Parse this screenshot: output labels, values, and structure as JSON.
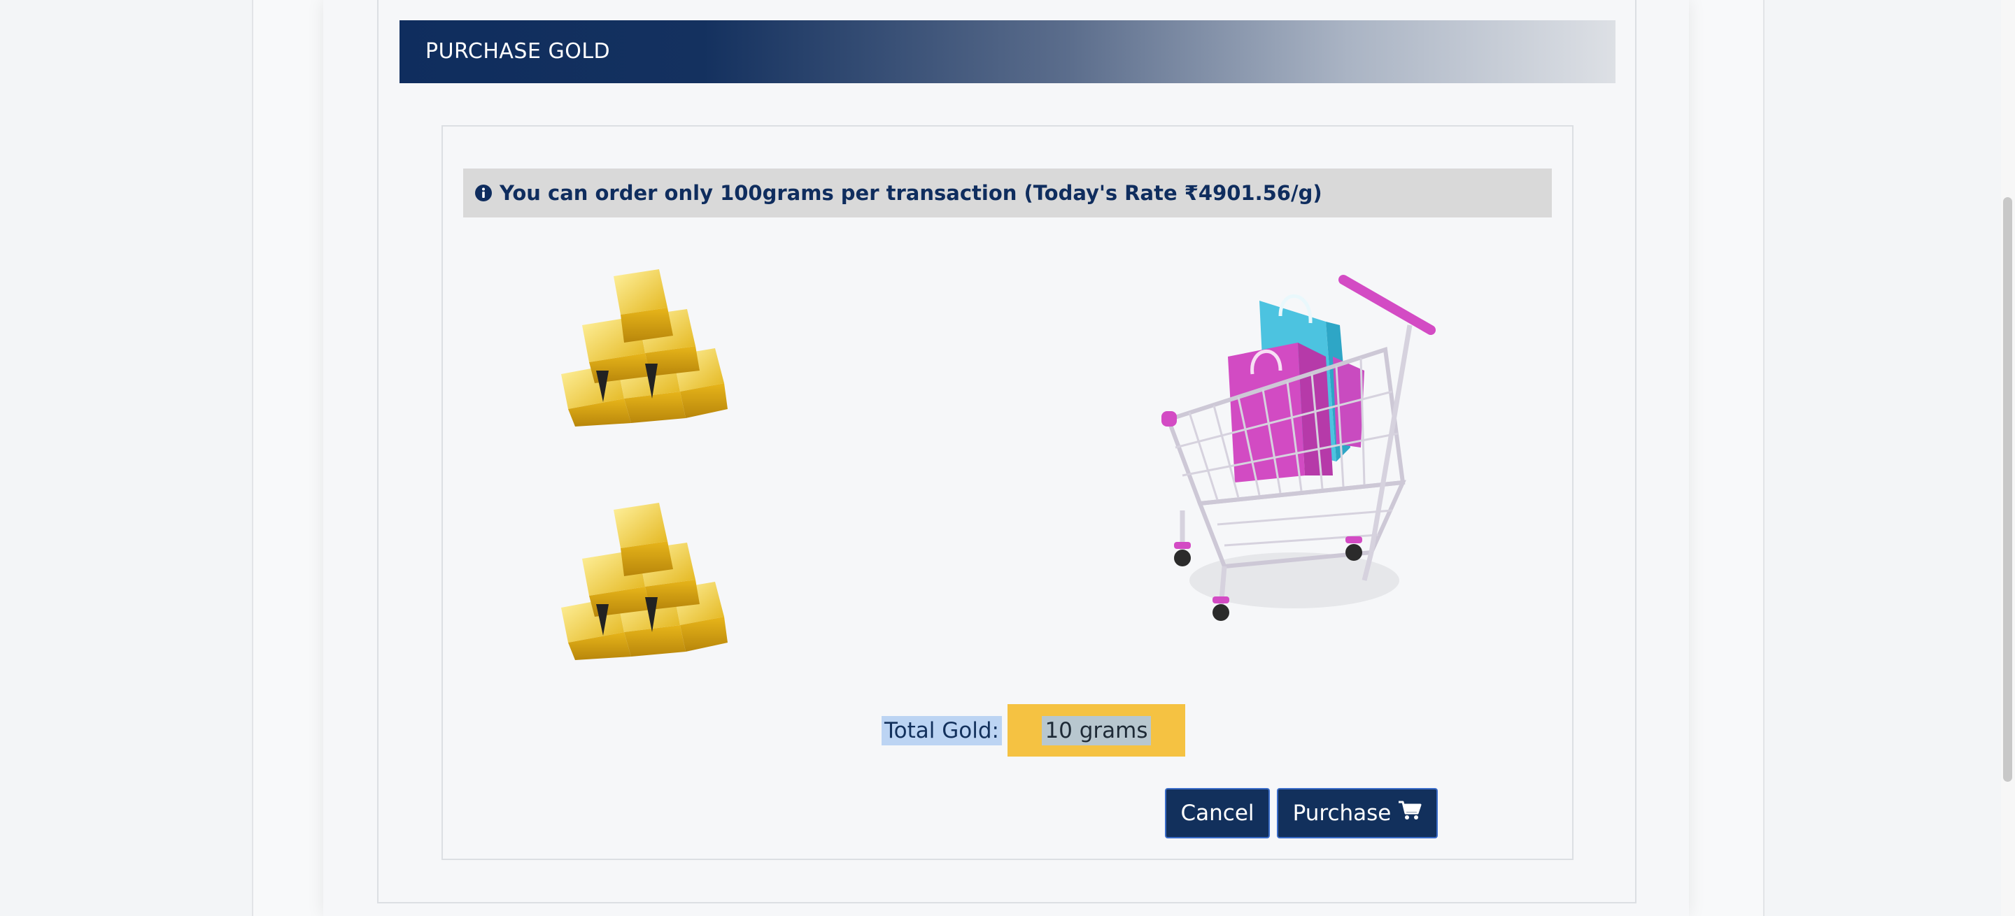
{
  "header": {
    "title": "PURCHASE GOLD"
  },
  "info": {
    "icon": "info-circle-icon",
    "message": "You can order only 100grams per transaction (Today's Rate ₹4901.56/g)"
  },
  "images": {
    "gold_bars": "gold-bars-icon",
    "cart": "shopping-cart-with-bags-icon"
  },
  "total": {
    "label": "Total Gold:",
    "value": "10 grams"
  },
  "buttons": {
    "cancel": "Cancel",
    "purchase": "Purchase",
    "purchase_icon": "cart-icon"
  },
  "colors": {
    "primary": "#12305c",
    "header_gradient_start": "#0f2d5e",
    "header_gradient_end": "#dde0e5",
    "banner_bg": "#d9d9d9",
    "total_box": "#f5c242",
    "gold": "#e6b820",
    "cart_bag_pink": "#d24bc3",
    "cart_bag_blue": "#4cc3e0"
  }
}
